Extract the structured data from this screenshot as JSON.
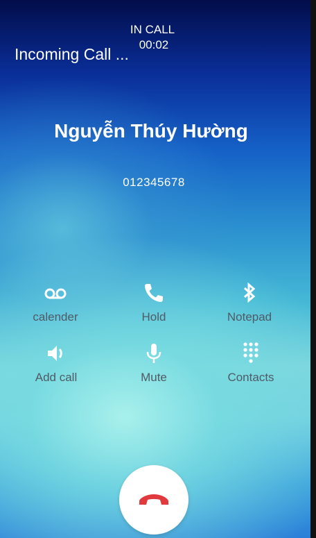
{
  "status": {
    "call_state": "IN CALL",
    "duration": "00:02",
    "incoming_label": "Incoming Call ..."
  },
  "caller": {
    "name": "Nguyễn Thúy Hường",
    "number": "012345678"
  },
  "actions": [
    {
      "label": "calender",
      "icon": "voicemail-icon"
    },
    {
      "label": "Hold",
      "icon": "phone-icon"
    },
    {
      "label": "Notepad",
      "icon": "bluetooth-icon"
    },
    {
      "label": "Add call",
      "icon": "speaker-icon"
    },
    {
      "label": "Mute",
      "icon": "microphone-icon"
    },
    {
      "label": "Contacts",
      "icon": "dialpad-icon"
    }
  ],
  "end_call": {
    "icon": "hang-up-icon",
    "color": "#e0393e"
  }
}
